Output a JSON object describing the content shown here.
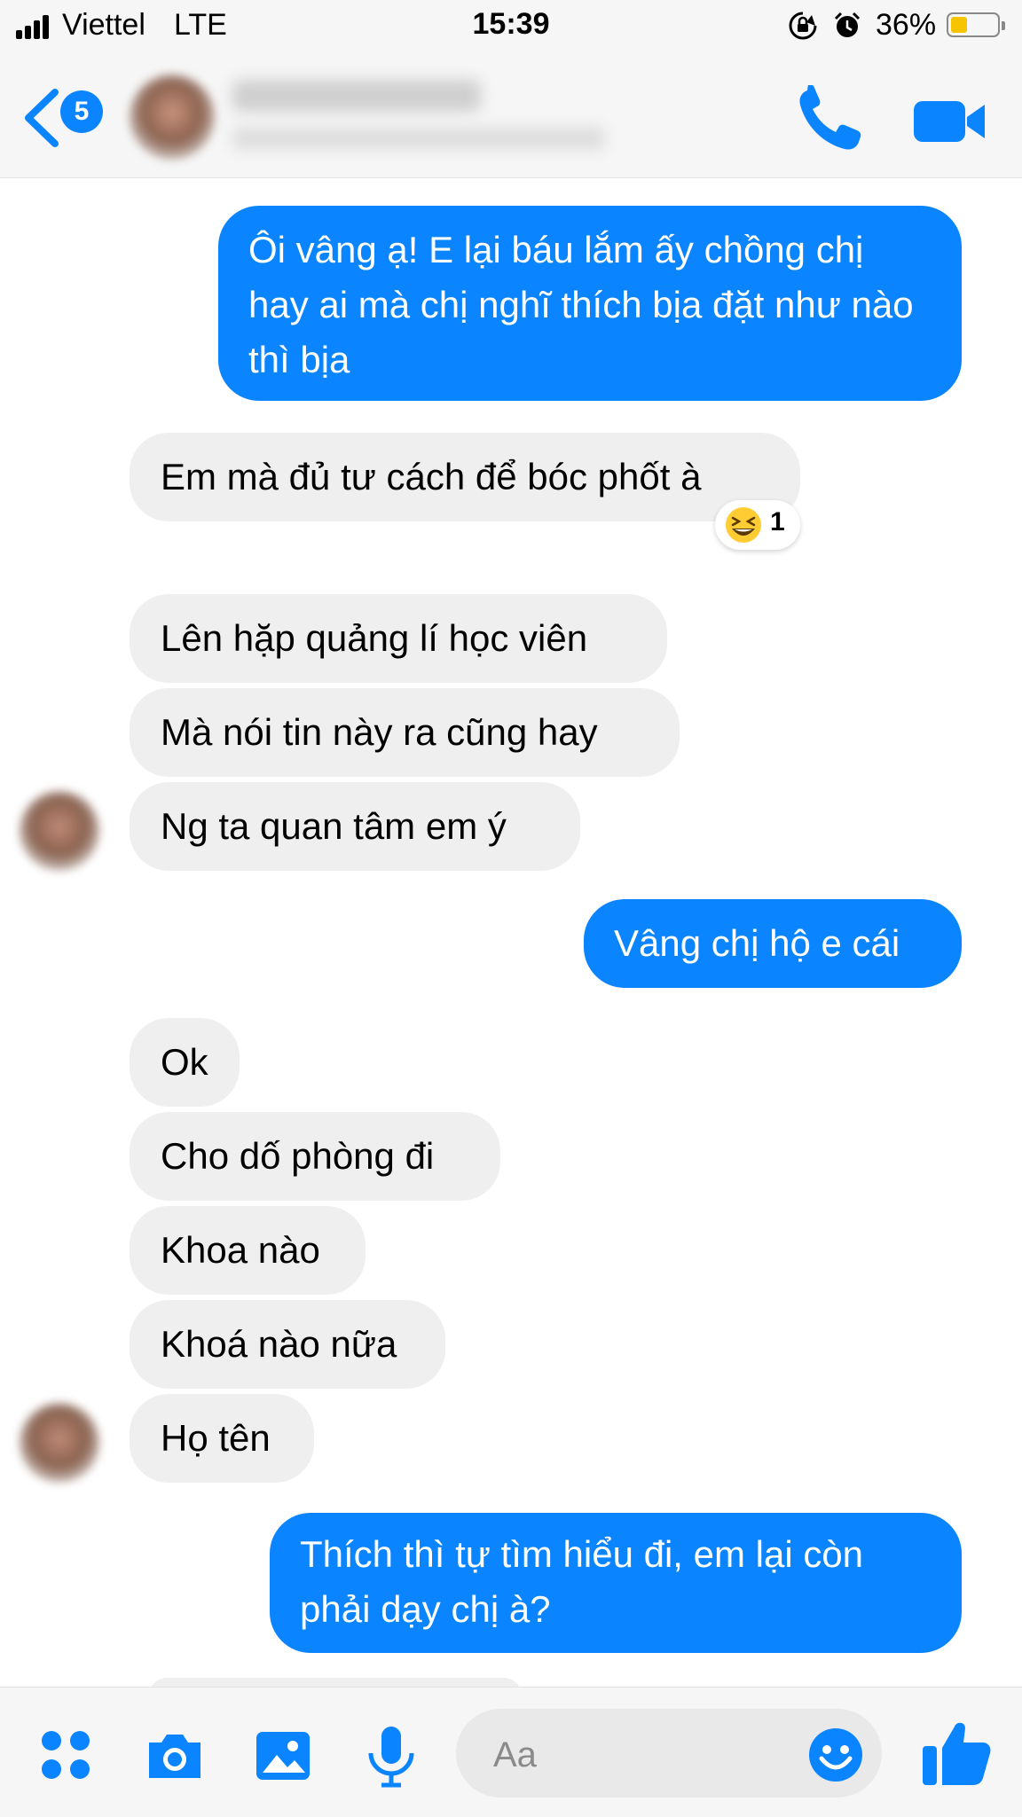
{
  "status_bar": {
    "carrier": "Viettel",
    "network": "LTE",
    "time": "15:39",
    "battery_percent": "36%",
    "battery_level": 0.36,
    "icons": [
      "signal-icon",
      "rotation-lock-icon",
      "alarm-icon",
      "battery-icon"
    ]
  },
  "header": {
    "back_badge": "5",
    "icons": [
      "back-chevron-icon",
      "phone-icon",
      "video-camera-icon"
    ]
  },
  "messages": [
    {
      "side": "sent",
      "text": "Ôi vâng ạ! E lại báu lắm ấy chồng chị hay ai mà chị nghĩ thích bịa đặt như nào thì bịa"
    },
    {
      "side": "received",
      "text": "Em mà đủ tư cách để bóc phốt à",
      "reaction": {
        "emoji": "grinning-squint-emoji",
        "count": "1"
      }
    },
    {
      "side": "received",
      "text": "Lên hặp quảng lí học viên"
    },
    {
      "side": "received",
      "text": "Mà nói tin này ra cũng hay"
    },
    {
      "side": "received",
      "text": "Ng ta quan tâm em ý"
    },
    {
      "side": "sent",
      "text": "Vâng chị hộ e cái"
    },
    {
      "side": "received",
      "text": "Ok"
    },
    {
      "side": "received",
      "text": "Cho dố phòng đi"
    },
    {
      "side": "received",
      "text": "Khoa nào"
    },
    {
      "side": "received",
      "text": "Khoá nào nữa"
    },
    {
      "side": "received",
      "text": "Họ tên"
    },
    {
      "side": "sent",
      "text": "Thích thì tự tìm hiểu đi, em lại còn phải dạy chị à?"
    }
  ],
  "composer": {
    "placeholder": "Aa",
    "icons": [
      "apps-grid-icon",
      "camera-icon",
      "gallery-icon",
      "microphone-icon",
      "emoji-smile-icon",
      "thumbs-up-icon"
    ]
  },
  "colors": {
    "accent": "#0a84ff",
    "received_bubble": "#efefef",
    "bar_background": "#f6f6f6",
    "battery_fill": "#f7c500"
  }
}
